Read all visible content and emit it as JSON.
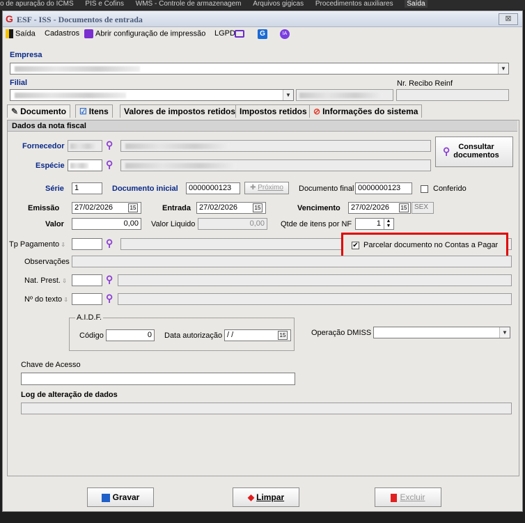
{
  "topbar": {
    "items": [
      "o de apuração do ICMS",
      "PIS e Cofins",
      "WMS - Controle de armazenagem",
      "Arquivos gigicas",
      "Procedimentos auxiliares",
      "Saída"
    ]
  },
  "window": {
    "title": "ESF - ISS - Documentos de entrada",
    "close": "⊠"
  },
  "menu": {
    "saida": "Saída",
    "cadastros": "Cadastros",
    "config": "Abrir configuração de impressão",
    "lgpd": "LGPD"
  },
  "empresa": {
    "label": "Empresa"
  },
  "filial": {
    "label": "Filial",
    "recibo_label": "Nr. Recibo Reinf"
  },
  "tabs": [
    "Documento",
    "Itens",
    "Valores de impostos retidos",
    "Impostos retidos",
    "Informações do sistema"
  ],
  "section": {
    "title": "Dados da nota fiscal"
  },
  "fields": {
    "fornecedor": "Fornecedor",
    "especie": "Espécie",
    "consultar": "Consultar documentos",
    "serie_label": "Série",
    "serie": "1",
    "doc_inicial_label": "Documento inicial",
    "doc_inicial": "0000000123",
    "proximo": "Próximo",
    "doc_final_label": "Documento final",
    "doc_final": "0000000123",
    "conferido": "Conferido",
    "emissao_label": "Emissão",
    "emissao": "27/02/2026",
    "entrada_label": "Entrada",
    "entrada": "27/02/2026",
    "vencimento_label": "Vencimento",
    "vencimento": "27/02/2026",
    "dia": "SEX",
    "valor_label": "Valor",
    "valor": "0,00",
    "valor_liq_label": "Valor Liquido",
    "valor_liq": "0,00",
    "qtde_label": "Qtde de itens por NF",
    "qtde": "1",
    "tp_pag": "Tp Pagamento",
    "parcelar": "Parcelar documento no Contas a Pagar",
    "observacoes": "Observações",
    "nat_prest": "Nat. Prest.",
    "nr_texto": "Nº do texto",
    "aidf": "A.I.D.F.",
    "codigo_label": "Código",
    "codigo": "0",
    "data_aut_label": "Data autorização",
    "data_aut": " / /",
    "dmiss": "Operação DMISS",
    "chave": "Chave de Acesso",
    "log": "Log de alteração de dados"
  },
  "buttons": {
    "gravar": "Gravar",
    "limpar": "Limpar",
    "excluir": "Excluir"
  },
  "colors": {
    "accent_red": "#e00000",
    "label_blue": "#0a2a8a",
    "search_purple": "#8b3fd6"
  }
}
